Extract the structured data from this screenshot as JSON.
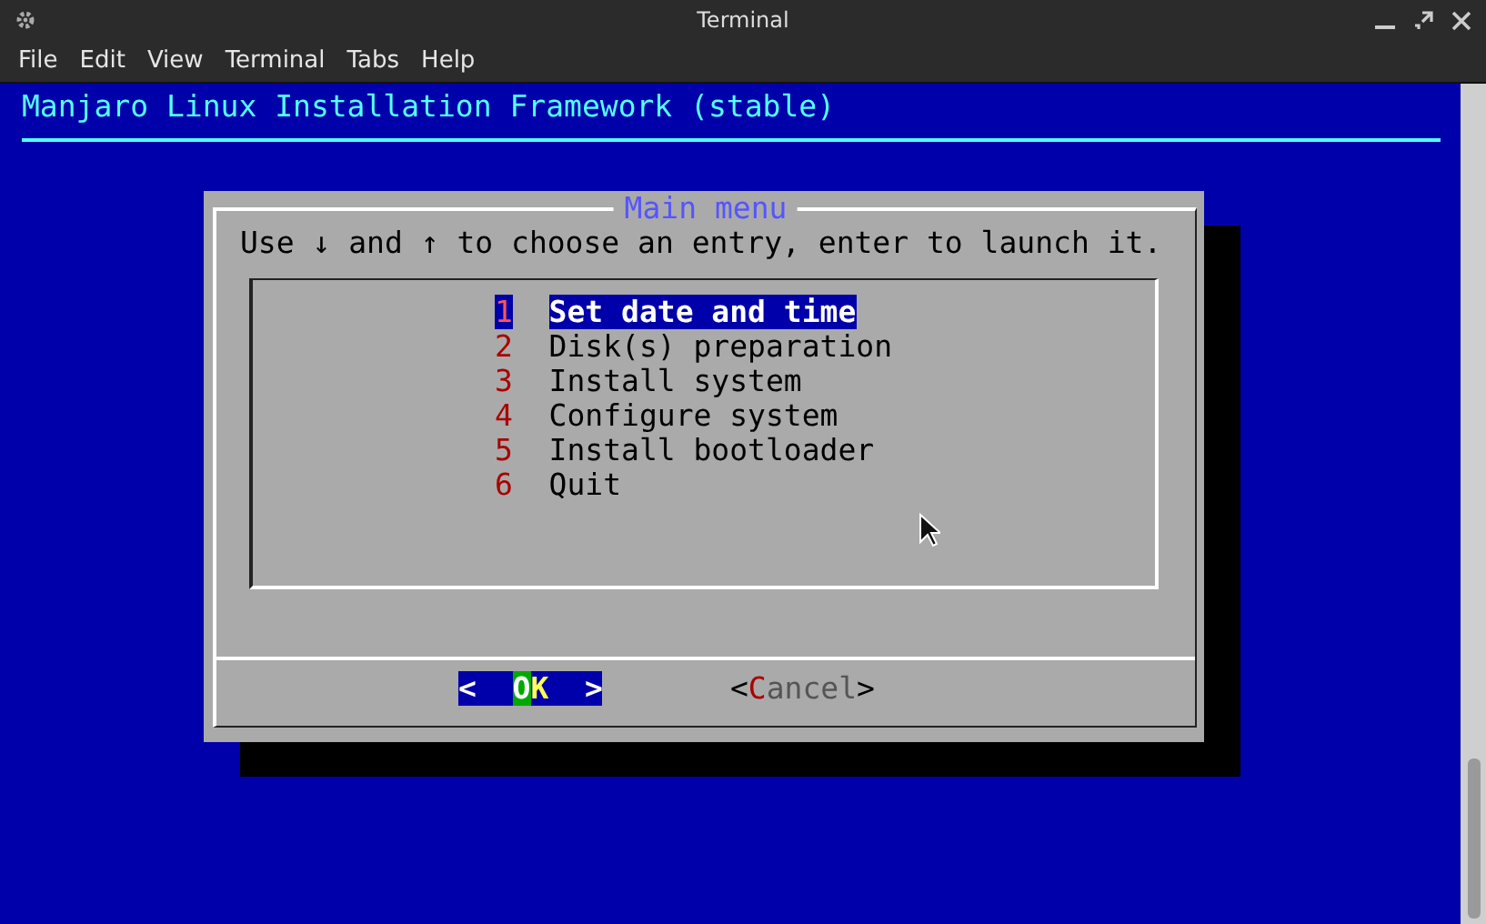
{
  "window": {
    "title": "Terminal"
  },
  "menu_bar": [
    "File",
    "Edit",
    "View",
    "Terminal",
    "Tabs",
    "Help"
  ],
  "backtitle": "Manjaro Linux Installation Framework (stable)",
  "dialog": {
    "title": "Main menu",
    "prompt": "Use ↓ and ↑ to choose an entry, enter to launch it.",
    "items": [
      {
        "tag": "1",
        "label": "Set date and time",
        "selected": true
      },
      {
        "tag": "2",
        "label": "Disk(s) preparation",
        "selected": false
      },
      {
        "tag": "3",
        "label": "Install system",
        "selected": false
      },
      {
        "tag": "4",
        "label": "Configure system",
        "selected": false
      },
      {
        "tag": "5",
        "label": "Install bootloader",
        "selected": false
      },
      {
        "tag": "6",
        "label": "Quit",
        "selected": false
      }
    ],
    "buttons": [
      {
        "open": "<",
        "label": "OK",
        "close": ">",
        "selected": true
      },
      {
        "open": "<",
        "label": "Cancel",
        "close": ">",
        "selected": false
      }
    ]
  }
}
